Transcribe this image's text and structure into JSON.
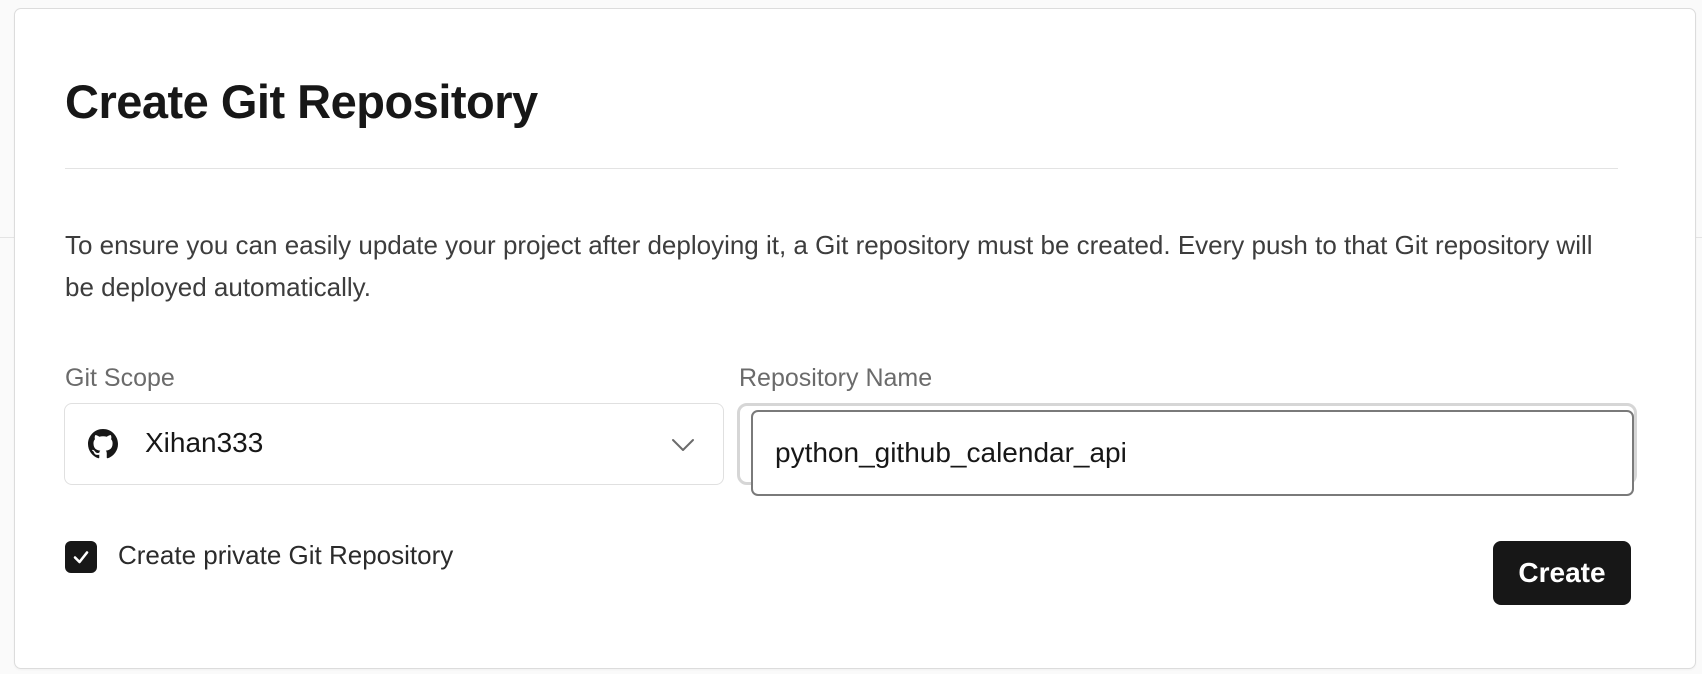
{
  "dialog": {
    "title": "Create Git Repository",
    "description": "To ensure you can easily update your project after deploying it, a Git repository must be created. Every push to that Git repository will be deployed automatically."
  },
  "git_scope": {
    "label": "Git Scope",
    "selected": "Xihan333",
    "icon": "github-icon"
  },
  "repository_name": {
    "label": "Repository Name",
    "value": "python_github_calendar_api"
  },
  "private_repo": {
    "label": "Create private Git Repository",
    "checked": true
  },
  "actions": {
    "create_label": "Create"
  },
  "colors": {
    "primary": "#171717",
    "muted_text": "#6b6b6b",
    "border": "#e0e0e0"
  }
}
